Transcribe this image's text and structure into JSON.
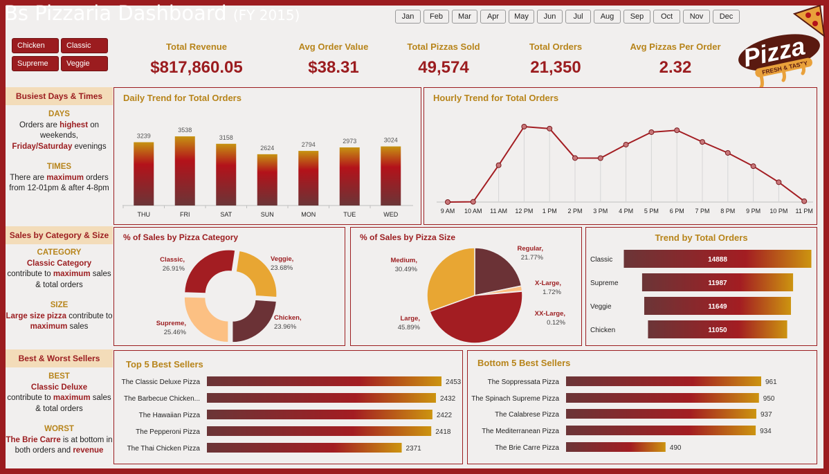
{
  "header": {
    "title": "Bs Pizzaria Dashboard",
    "fy": "(FY 2015)"
  },
  "months": [
    "Jan",
    "Feb",
    "Mar",
    "Apr",
    "May",
    "Jun",
    "Jul",
    "Aug",
    "Sep",
    "Oct",
    "Nov",
    "Dec"
  ],
  "category_slicers": [
    "Chicken",
    "Classic",
    "Supreme",
    "Veggie"
  ],
  "kpis": [
    {
      "label": "Total Revenue",
      "value": "$817,860.05"
    },
    {
      "label": "Avg Order Value",
      "value": "$38.31"
    },
    {
      "label": "Total Pizzas Sold",
      "value": "49,574"
    },
    {
      "label": "Total Orders",
      "value": "21,350"
    },
    {
      "label": "Avg Pizzas Per Order",
      "value": "2.32"
    }
  ],
  "logo": {
    "text": "Pizza",
    "tagline": "FRESH & TASTY"
  },
  "sidebar": {
    "days_times": {
      "heading": "Busiest Days & Times",
      "days_head": "DAYS",
      "days_1": "Orders are ",
      "days_2": "highest",
      "days_3": " on weekends,",
      "days_4": "Friday/Saturday",
      "days_5": " evenings",
      "times_head": "TIMES",
      "times_1": "There are ",
      "times_2": "maximum",
      "times_3": " orders from 12-01pm & after 4-8pm"
    },
    "category_size": {
      "heading": "Sales by Category & Size",
      "cat_head": "CATEGORY",
      "cat_1": "Classic Category",
      "cat_2": "contribute to ",
      "cat_3": "maximum",
      "cat_4": " sales & total orders",
      "size_head": "SIZE",
      "size_1": "Large size pizza",
      "size_2": " contribute to ",
      "size_3": "maximum",
      "size_4": " sales"
    },
    "best_worst": {
      "heading": "Best & Worst Sellers",
      "best_head": "BEST",
      "best_1": "Classic Deluxe",
      "best_2": "contribute to ",
      "best_3": "maximum",
      "best_4": " sales & total orders",
      "worst_head": "WORST",
      "worst_1": "The Brie Carre",
      "worst_2": " is at bottom in both orders and ",
      "worst_3": "revenue"
    }
  },
  "chart_data": [
    {
      "id": "daily",
      "type": "bar",
      "title": "Daily Trend for Total Orders",
      "categories": [
        "THU",
        "FRI",
        "SAT",
        "SUN",
        "MON",
        "TUE",
        "WED"
      ],
      "values": [
        3239,
        3538,
        3158,
        2624,
        2794,
        2973,
        3024
      ]
    },
    {
      "id": "hourly",
      "type": "line",
      "title": "Hourly Trend for Total Orders",
      "categories": [
        "9 AM",
        "10 AM",
        "11 AM",
        "12 PM",
        "1 PM",
        "2 PM",
        "3 PM",
        "4 PM",
        "5 PM",
        "6 PM",
        "7 PM",
        "8 PM",
        "9 PM",
        "10 PM",
        "11 PM"
      ],
      "values": [
        1,
        8,
        1231,
        2520,
        2455,
        1472,
        1468,
        1920,
        2336,
        2399,
        2009,
        1642,
        1198,
        663,
        28
      ]
    },
    {
      "id": "category",
      "type": "pie",
      "subtype": "donut",
      "title": "% of Sales by Pizza Category",
      "slices": [
        {
          "name": "Classic,",
          "pct": "26.91%",
          "value": 26.91,
          "color": "#a31d22"
        },
        {
          "name": "Veggie,",
          "pct": "23.68%",
          "value": 23.68,
          "color": "#e8a633"
        },
        {
          "name": "Chicken,",
          "pct": "23.96%",
          "value": 23.96,
          "color": "#6b3236"
        },
        {
          "name": "Supreme,",
          "pct": "25.46%",
          "value": 25.46,
          "color": "#fcc083"
        }
      ]
    },
    {
      "id": "size",
      "type": "pie",
      "title": "% of Sales by Pizza Size",
      "slices": [
        {
          "name": "Regular,",
          "pct": "21.77%",
          "value": 21.77,
          "color": "#6b3236"
        },
        {
          "name": "X-Large,",
          "pct": "1.72%",
          "value": 1.72,
          "color": "#fcc083"
        },
        {
          "name": "XX-Large,",
          "pct": "0.12%",
          "value": 0.12,
          "color": "#f4d9b2"
        },
        {
          "name": "Large,",
          "pct": "45.89%",
          "value": 45.89,
          "color": "#a31d22"
        },
        {
          "name": "Medium,",
          "pct": "30.49%",
          "value": 30.49,
          "color": "#e8a633"
        }
      ]
    },
    {
      "id": "category_orders",
      "type": "bar",
      "orientation": "horizontal",
      "title": "Trend by Total Orders",
      "categories": [
        "Classic",
        "Supreme",
        "Veggie",
        "Chicken"
      ],
      "values": [
        14888,
        11987,
        11649,
        11050
      ]
    },
    {
      "id": "top5",
      "type": "bar",
      "orientation": "horizontal",
      "title": "Top 5 Best Sellers",
      "categories": [
        "The Classic Deluxe Pizza",
        "The Barbecue Chicken...",
        "The Hawaiian Pizza",
        "The Pepperoni Pizza",
        "The Thai Chicken Pizza"
      ],
      "values": [
        2453,
        2432,
        2422,
        2418,
        2371
      ]
    },
    {
      "id": "bottom5",
      "type": "bar",
      "orientation": "horizontal",
      "title": "Bottom 5 Best Sellers",
      "categories": [
        "The Soppressata Pizza",
        "The Spinach Supreme Pizza",
        "The Calabrese Pizza",
        "The Mediterranean Pizza",
        "The Brie Carre Pizza"
      ],
      "values": [
        961,
        950,
        937,
        934,
        490
      ]
    }
  ]
}
